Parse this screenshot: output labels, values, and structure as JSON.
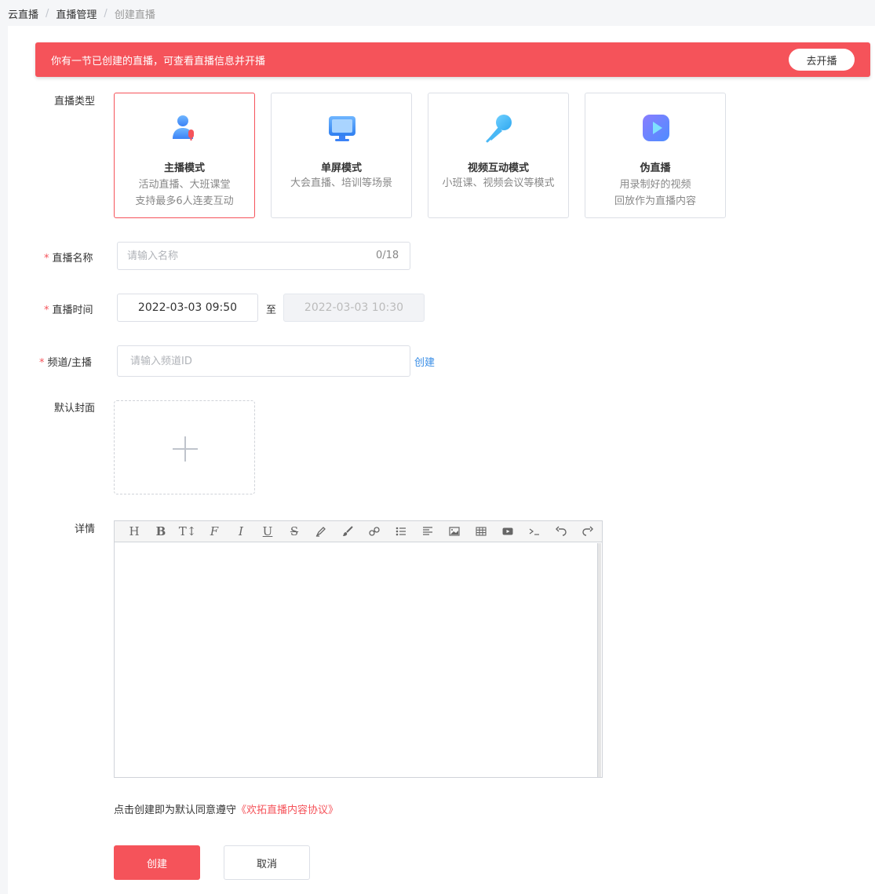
{
  "breadcrumb": {
    "items": [
      "云直播",
      "直播管理",
      "创建直播"
    ],
    "separator": "/"
  },
  "alert": {
    "text": "你有一节已创建的直播，可查看直播信息并开播",
    "button_label": "去开播",
    "color": "#f5535a"
  },
  "form": {
    "type_label": "直播类型",
    "types": [
      {
        "title": "主播模式",
        "desc1": "活动直播、大班课堂",
        "desc2": "支持最多6人连麦互动",
        "icon": "anchor-person-icon",
        "selected": true
      },
      {
        "title": "单屏模式",
        "desc1": "大会直播、培训等场景",
        "desc2": "",
        "icon": "monitor-icon",
        "selected": false
      },
      {
        "title": "视频互动模式",
        "desc1": "小班课、视频会议等模式",
        "desc2": "",
        "icon": "microphone-icon",
        "selected": false
      },
      {
        "title": "伪直播",
        "desc1": "用录制好的视频",
        "desc2": "回放作为直播内容",
        "icon": "play-video-icon",
        "selected": false
      }
    ],
    "name_label": "直播名称",
    "name_placeholder": "请输入名称",
    "name_counter": "0/18",
    "time_label": "直播时间",
    "start_time": "2022-03-03 09:50",
    "to_text": "至",
    "end_time": "2022-03-03 10:30",
    "channel_label": "频道/主播",
    "channel_placeholder": "请输入频道ID",
    "channel_create_link": "创建",
    "cover_label": "默认封面",
    "detail_label": "详情",
    "required_mark": "*"
  },
  "editor": {
    "toolbar": [
      "heading-icon",
      "bold-icon",
      "text-size-icon",
      "font-icon",
      "italic-icon",
      "underline-icon",
      "strikethrough-icon",
      "highlighter-icon",
      "brush-icon",
      "link-icon",
      "bulleted-list-icon",
      "align-icon",
      "image-icon",
      "table-icon",
      "video-icon",
      "code-icon",
      "undo-icon",
      "redo-icon"
    ]
  },
  "agreement": {
    "prefix": "点击创建即为默认同意遵守",
    "link": "《欢拓直播内容协议》"
  },
  "buttons": {
    "create": "创建",
    "cancel": "取消"
  },
  "colors": {
    "accent": "#f5535a",
    "link": "#3a8ee6"
  }
}
